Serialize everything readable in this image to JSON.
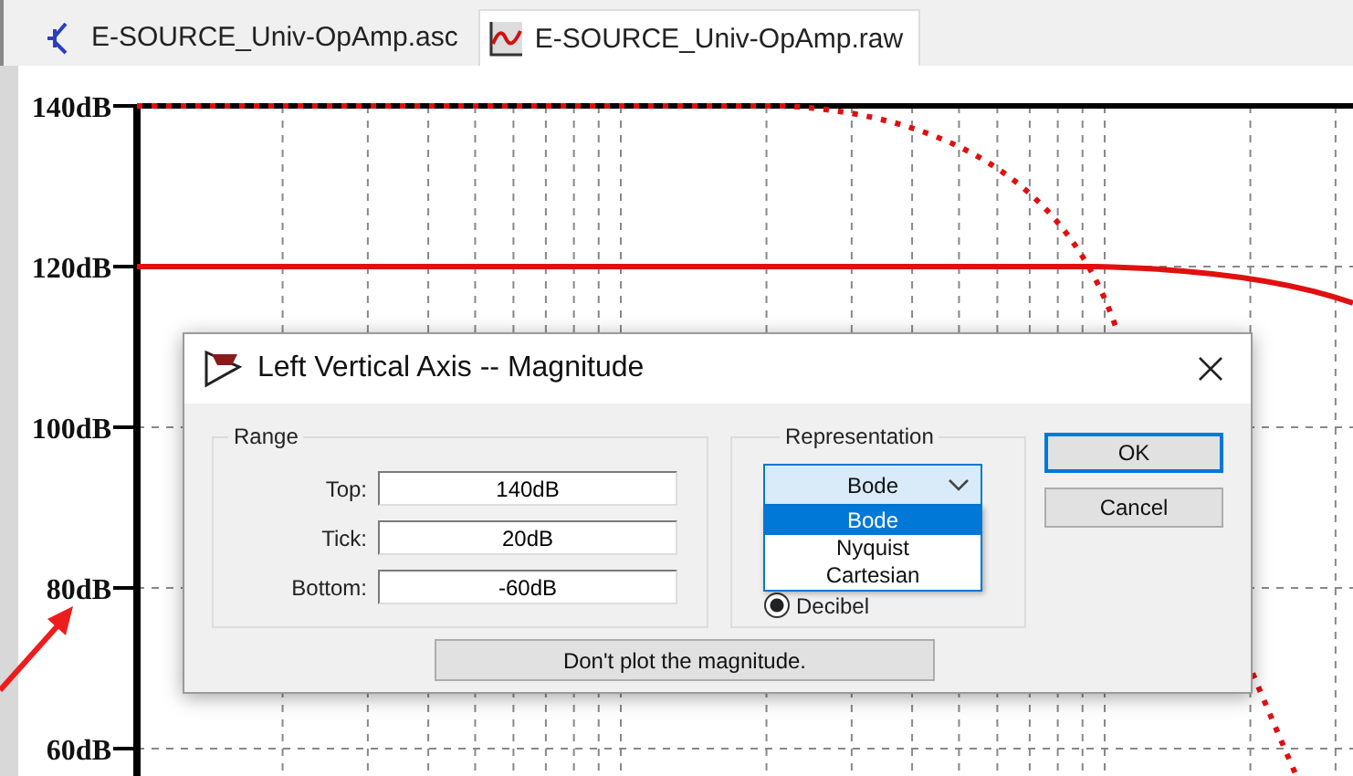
{
  "tabs": [
    {
      "label": "E-SOURCE_Univ-OpAmp.asc",
      "kind": "schematic",
      "selected": false
    },
    {
      "label": "E-SOURCE_Univ-OpAmp.raw",
      "kind": "waveform",
      "selected": true
    }
  ],
  "plot": {
    "y_axis_labels": [
      "140dB",
      "120dB",
      "100dB",
      "80dB",
      "60dB"
    ]
  },
  "dialog": {
    "title": "Left Vertical Axis -- Magnitude",
    "range": {
      "title": "Range",
      "fields": [
        {
          "label": "Top:",
          "value": "140dB"
        },
        {
          "label": "Tick:",
          "value": "20dB"
        },
        {
          "label": "Bottom:",
          "value": "-60dB"
        }
      ]
    },
    "representation": {
      "title": "Representation",
      "dropdown": {
        "value": "Bode",
        "expanded": true,
        "options": [
          {
            "label": "Bode",
            "selected": true
          },
          {
            "label": "Nyquist",
            "selected": false
          },
          {
            "label": "Cartesian",
            "selected": false
          }
        ]
      },
      "radios": [
        {
          "label": "Decibel",
          "selected": true
        }
      ]
    },
    "buttons": [
      {
        "label": "OK",
        "default": true
      },
      {
        "label": "Cancel",
        "default": false
      }
    ],
    "action_button": "Don't plot the magnitude."
  }
}
